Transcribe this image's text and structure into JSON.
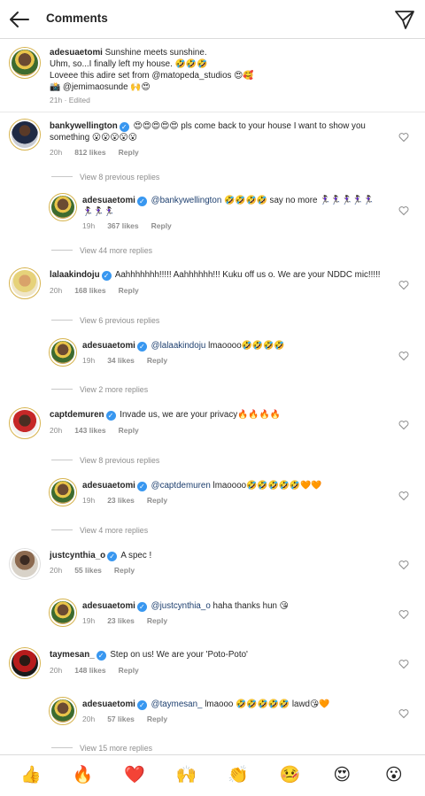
{
  "header": {
    "title": "Comments",
    "back_icon": "arrow-left-icon",
    "send_icon": "paper-plane-icon"
  },
  "caption": {
    "username": "adesuaetomi",
    "lines": [
      "Sunshine meets sunshine.",
      "Uhm, so...I finally left my house. 🤣🤣🤣",
      "Loveee this adire set from @matopeda_studios 😍🥰",
      "📸 @jemimaosunde 🙌😍"
    ],
    "time": "21h",
    "edited": "· Edited"
  },
  "comments": [
    {
      "username": "bankywellington",
      "verified": true,
      "text": "😍😍😍😍😍 pls come back to your house I want to show you something 😮😮😮😮😮",
      "time": "20h",
      "likes": "812 likes",
      "reply": "Reply"
    },
    {
      "username": "adesuaetomi",
      "verified": true,
      "mention": "@bankywellington",
      "text": "🤣🤣🤣🤣 say no more 🏃🏿‍♀️🏃🏿‍♀️🏃🏿‍♀️🏃🏿‍♀️🏃🏿‍♀️🏃🏿‍♀️🏃🏿‍♀️🏃🏿‍♀️",
      "time": "19h",
      "likes": "367 likes",
      "reply": "Reply"
    },
    {
      "username": "lalaakindoju",
      "verified": true,
      "text": "Aahhhhhhh!!!!! Aahhhhhh!!! Kuku off us o. We are your NDDC mic!!!!!",
      "time": "20h",
      "likes": "168 likes",
      "reply": "Reply"
    },
    {
      "username": "adesuaetomi",
      "verified": true,
      "mention": "@lalaakindoju",
      "text": "lmaoooo🤣🤣🤣🤣",
      "time": "19h",
      "likes": "34 likes",
      "reply": "Reply"
    },
    {
      "username": "captdemuren",
      "verified": true,
      "text": "Invade us, we are your privacy🔥🔥🔥🔥",
      "time": "20h",
      "likes": "143 likes",
      "reply": "Reply"
    },
    {
      "username": "adesuaetomi",
      "verified": true,
      "mention": "@captdemuren",
      "text": "lmaoooo🤣🤣🤣🤣🤣🧡🧡",
      "time": "19h",
      "likes": "23 likes",
      "reply": "Reply"
    },
    {
      "username": "justcynthia_o",
      "verified": true,
      "text": "A spec !",
      "time": "20h",
      "likes": "55 likes",
      "reply": "Reply"
    },
    {
      "username": "adesuaetomi",
      "verified": true,
      "mention": "@justcynthia_o",
      "text": "haha thanks hun 😘",
      "time": "19h",
      "likes": "23 likes",
      "reply": "Reply"
    },
    {
      "username": "taymesan_",
      "verified": true,
      "text": "Step on us! We are your 'Poto-Poto'",
      "time": "20h",
      "likes": "148 likes",
      "reply": "Reply"
    },
    {
      "username": "adesuaetomi",
      "verified": true,
      "mention": "@taymesan_",
      "text": "lmaooo 🤣🤣🤣🤣🤣 lawd😘🧡",
      "time": "20h",
      "likes": "57 likes",
      "reply": "Reply"
    }
  ],
  "view_links": [
    "View 8 previous replies",
    "View 44 more replies",
    "View 6 previous replies",
    "View 2 more replies",
    "View 8 previous replies",
    "View 4 more replies",
    "View 15 more replies"
  ],
  "emoji_bar": [
    "👍",
    "🔥",
    "❤️",
    "🙌",
    "👏",
    "🤒",
    "😍",
    "😮"
  ],
  "colors": {
    "verified": "#3897f0",
    "secondary_text": "#8e8e8e",
    "mention": "#1d3f6f",
    "avatar_ring": "#d6b34d"
  }
}
